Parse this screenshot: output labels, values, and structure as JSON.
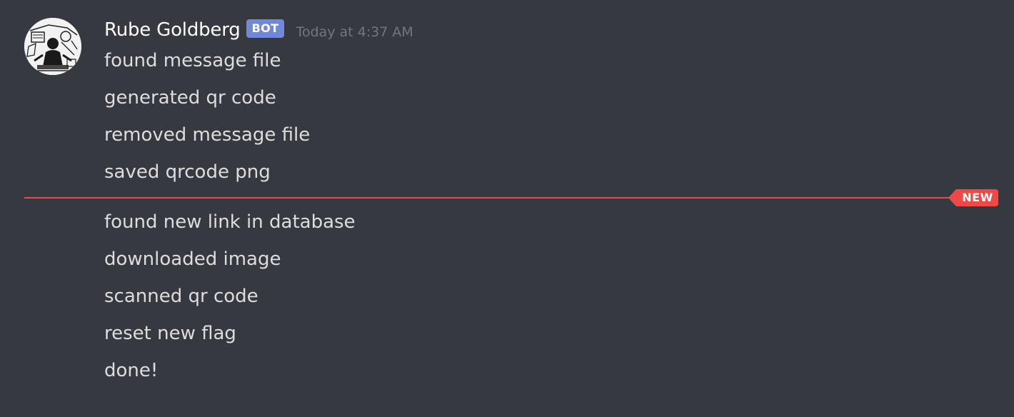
{
  "message": {
    "author": {
      "username": "Rube Goldberg",
      "bot_tag": "BOT",
      "avatar_icon": "rube-goldberg-cartoon-avatar"
    },
    "timestamp": "Today at 4:37 AM",
    "lines_before_divider": [
      "found message file",
      "generated qr code",
      "removed message file",
      "saved qrcode png"
    ],
    "lines_after_divider": [
      "found new link in database",
      "downloaded image",
      "scanned qr code",
      "reset new flag",
      "done!"
    ]
  },
  "divider": {
    "label": "NEW",
    "color": "#f04747"
  },
  "colors": {
    "background": "#36393f",
    "username": "#ffffff",
    "bot_tag": "#7289da",
    "timestamp": "#72767d",
    "message_text": "#dcddde"
  }
}
